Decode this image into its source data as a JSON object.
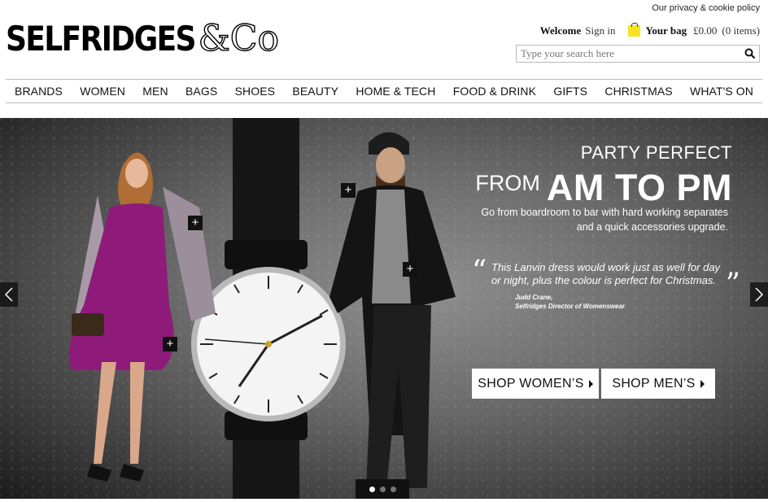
{
  "header": {
    "privacy_link": "Our privacy & cookie policy",
    "logo_text": "SELFRIDGES",
    "logo_amp": "&Co",
    "welcome": "Welcome",
    "sign_in": "Sign in",
    "bag_label": "Your bag",
    "bag_value": "£0.00",
    "bag_items": "(0 items)",
    "search_placeholder": "Type your search here"
  },
  "nav": {
    "items": [
      "BRANDS",
      "WOMEN",
      "MEN",
      "BAGS",
      "SHOES",
      "BEAUTY",
      "HOME & TECH",
      "FOOD & DRINK",
      "GIFTS",
      "CHRISTMAS",
      "WHAT'S ON"
    ]
  },
  "hero": {
    "kicker": "PARTY PERFECT",
    "from": "FROM",
    "headline": "AM TO PM",
    "sub_line1": "Go from boardroom to bar with hard working separates",
    "sub_line2": "and a quick accessories upgrade.",
    "quote": "This Lanvin dress would work just as well for day or night, plus the colour is perfect for Christmas.",
    "author_name": "Judd Crane,",
    "author_title": "Selfridges Director of Womenswear",
    "cta_women": "SHOP WOMEN’S",
    "cta_men": "SHOP MEN’S",
    "slides": 3,
    "active_slide": 1
  },
  "icons": {
    "plus": "+",
    "quote_open": "“",
    "quote_close": "”"
  },
  "colors": {
    "bag_icon": "#f7e321",
    "dress": "#8e1b7a"
  }
}
